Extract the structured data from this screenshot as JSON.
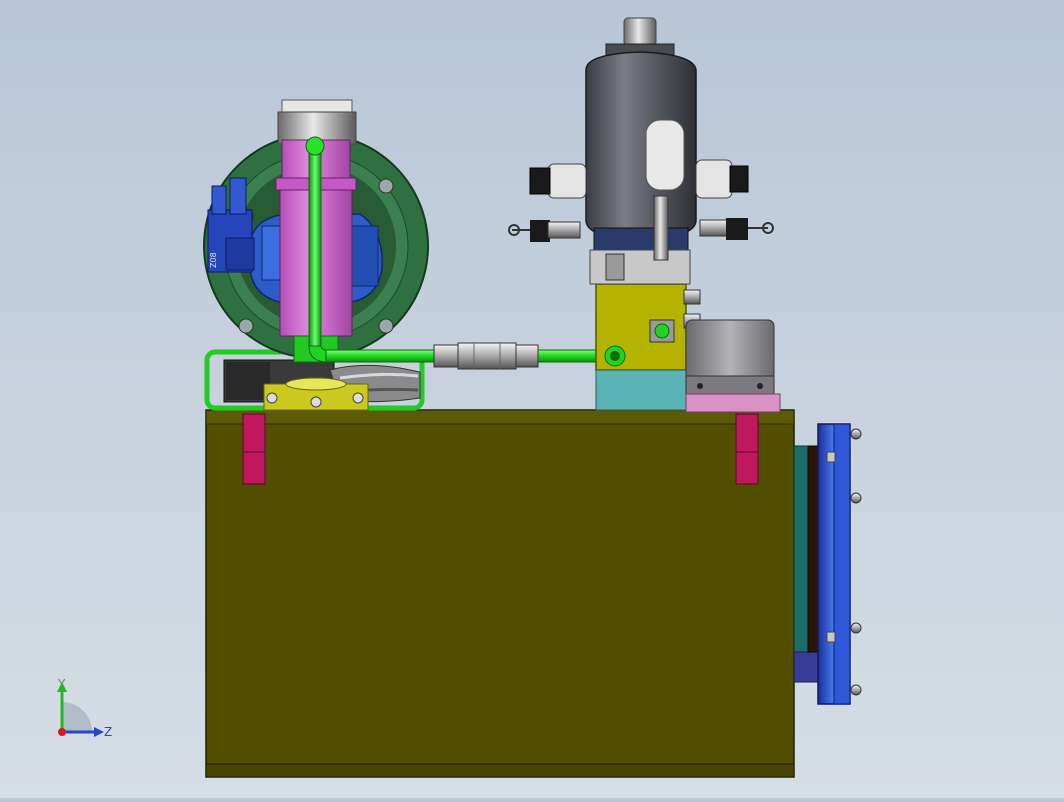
{
  "viewport": {
    "background_top": "#b9c6d6",
    "background_bottom": "#d6dde5"
  },
  "model": {
    "colors": {
      "tank_body": "#525000",
      "tank_edge": "#2f2e00",
      "lifting_lug": "#c0185e",
      "end_plate": "#2f57d8",
      "end_plate_gasket": "#2b1608",
      "end_plate_side": "#1c6d6a",
      "motor_flange": "#2f7040",
      "motor_pink": "#d26bd2",
      "pump_blue": "#2e5dc8",
      "pipe_green": "#22d422",
      "valve_block_yellow": "#b3b300",
      "valve_block_teal": "#59b3b3",
      "accumulator_gray": "#575a62",
      "filter_gray": "#8e8e90",
      "filter_base_pink": "#d892c6"
    },
    "part_label": "Z08"
  },
  "triad": {
    "y_label": "Y",
    "z_label": "Z",
    "y_color": "#26b526",
    "z_color": "#2b47c4",
    "x_color": "#d81b1b"
  }
}
